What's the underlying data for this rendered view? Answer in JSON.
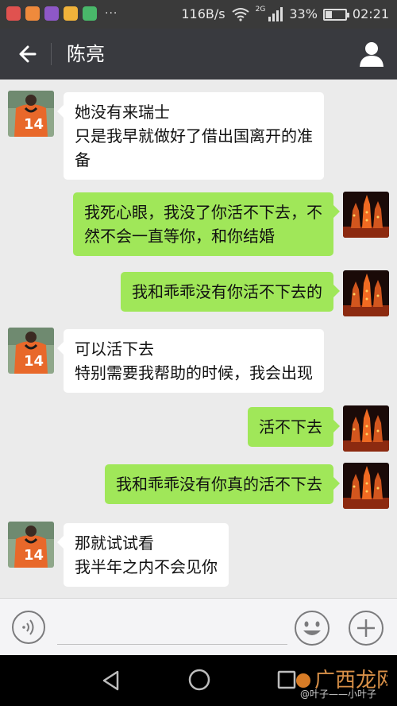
{
  "status_bar": {
    "network_speed": "116B/s",
    "network_type": "2G",
    "battery": "33%",
    "battery_level": 0.33,
    "time": "02:21",
    "notification_icons": [
      "app-icon-red",
      "app-icon-orange",
      "app-icon-purple",
      "app-icon-yellow",
      "app-icon-green"
    ],
    "more": "···"
  },
  "header": {
    "title": "陈亮",
    "back_icon": "arrow-left-icon",
    "contact_icon": "person-icon"
  },
  "messages": [
    {
      "direction": "in",
      "lines": [
        "她没有来瑞士",
        "只是我早就做好了借出国离开的准",
        "备"
      ]
    },
    {
      "direction": "out",
      "lines": [
        "我死心眼，我没了你活不下去，不",
        "然不会一直等你，和你结婚"
      ]
    },
    {
      "direction": "out",
      "lines": [
        "我和乖乖没有你活不下去的"
      ]
    },
    {
      "direction": "in",
      "lines": [
        "可以活下去",
        "特别需要我帮助的时候，我会出现"
      ]
    },
    {
      "direction": "out",
      "lines": [
        "活不下去"
      ]
    },
    {
      "direction": "out",
      "lines": [
        "我和乖乖没有你真的活不下去"
      ]
    },
    {
      "direction": "in",
      "lines": [
        "那就试试看",
        "我半年之内不会见你"
      ]
    }
  ],
  "input_bar": {
    "voice_icon": "voice-icon",
    "emoji_icon": "emoji-icon",
    "plus_icon": "plus-icon",
    "value": ""
  },
  "nav_bar": {
    "back_icon": "triangle-back-icon",
    "home_icon": "circle-home-icon",
    "recent_icon": "square-recent-icon"
  },
  "watermark": {
    "logo_text": "广西龙网",
    "text": "@叶子——小叶子"
  },
  "colors": {
    "header_bg": "#393a3f",
    "chat_bg": "#ebebeb",
    "bubble_out": "#a0e759",
    "bubble_in": "#ffffff"
  }
}
